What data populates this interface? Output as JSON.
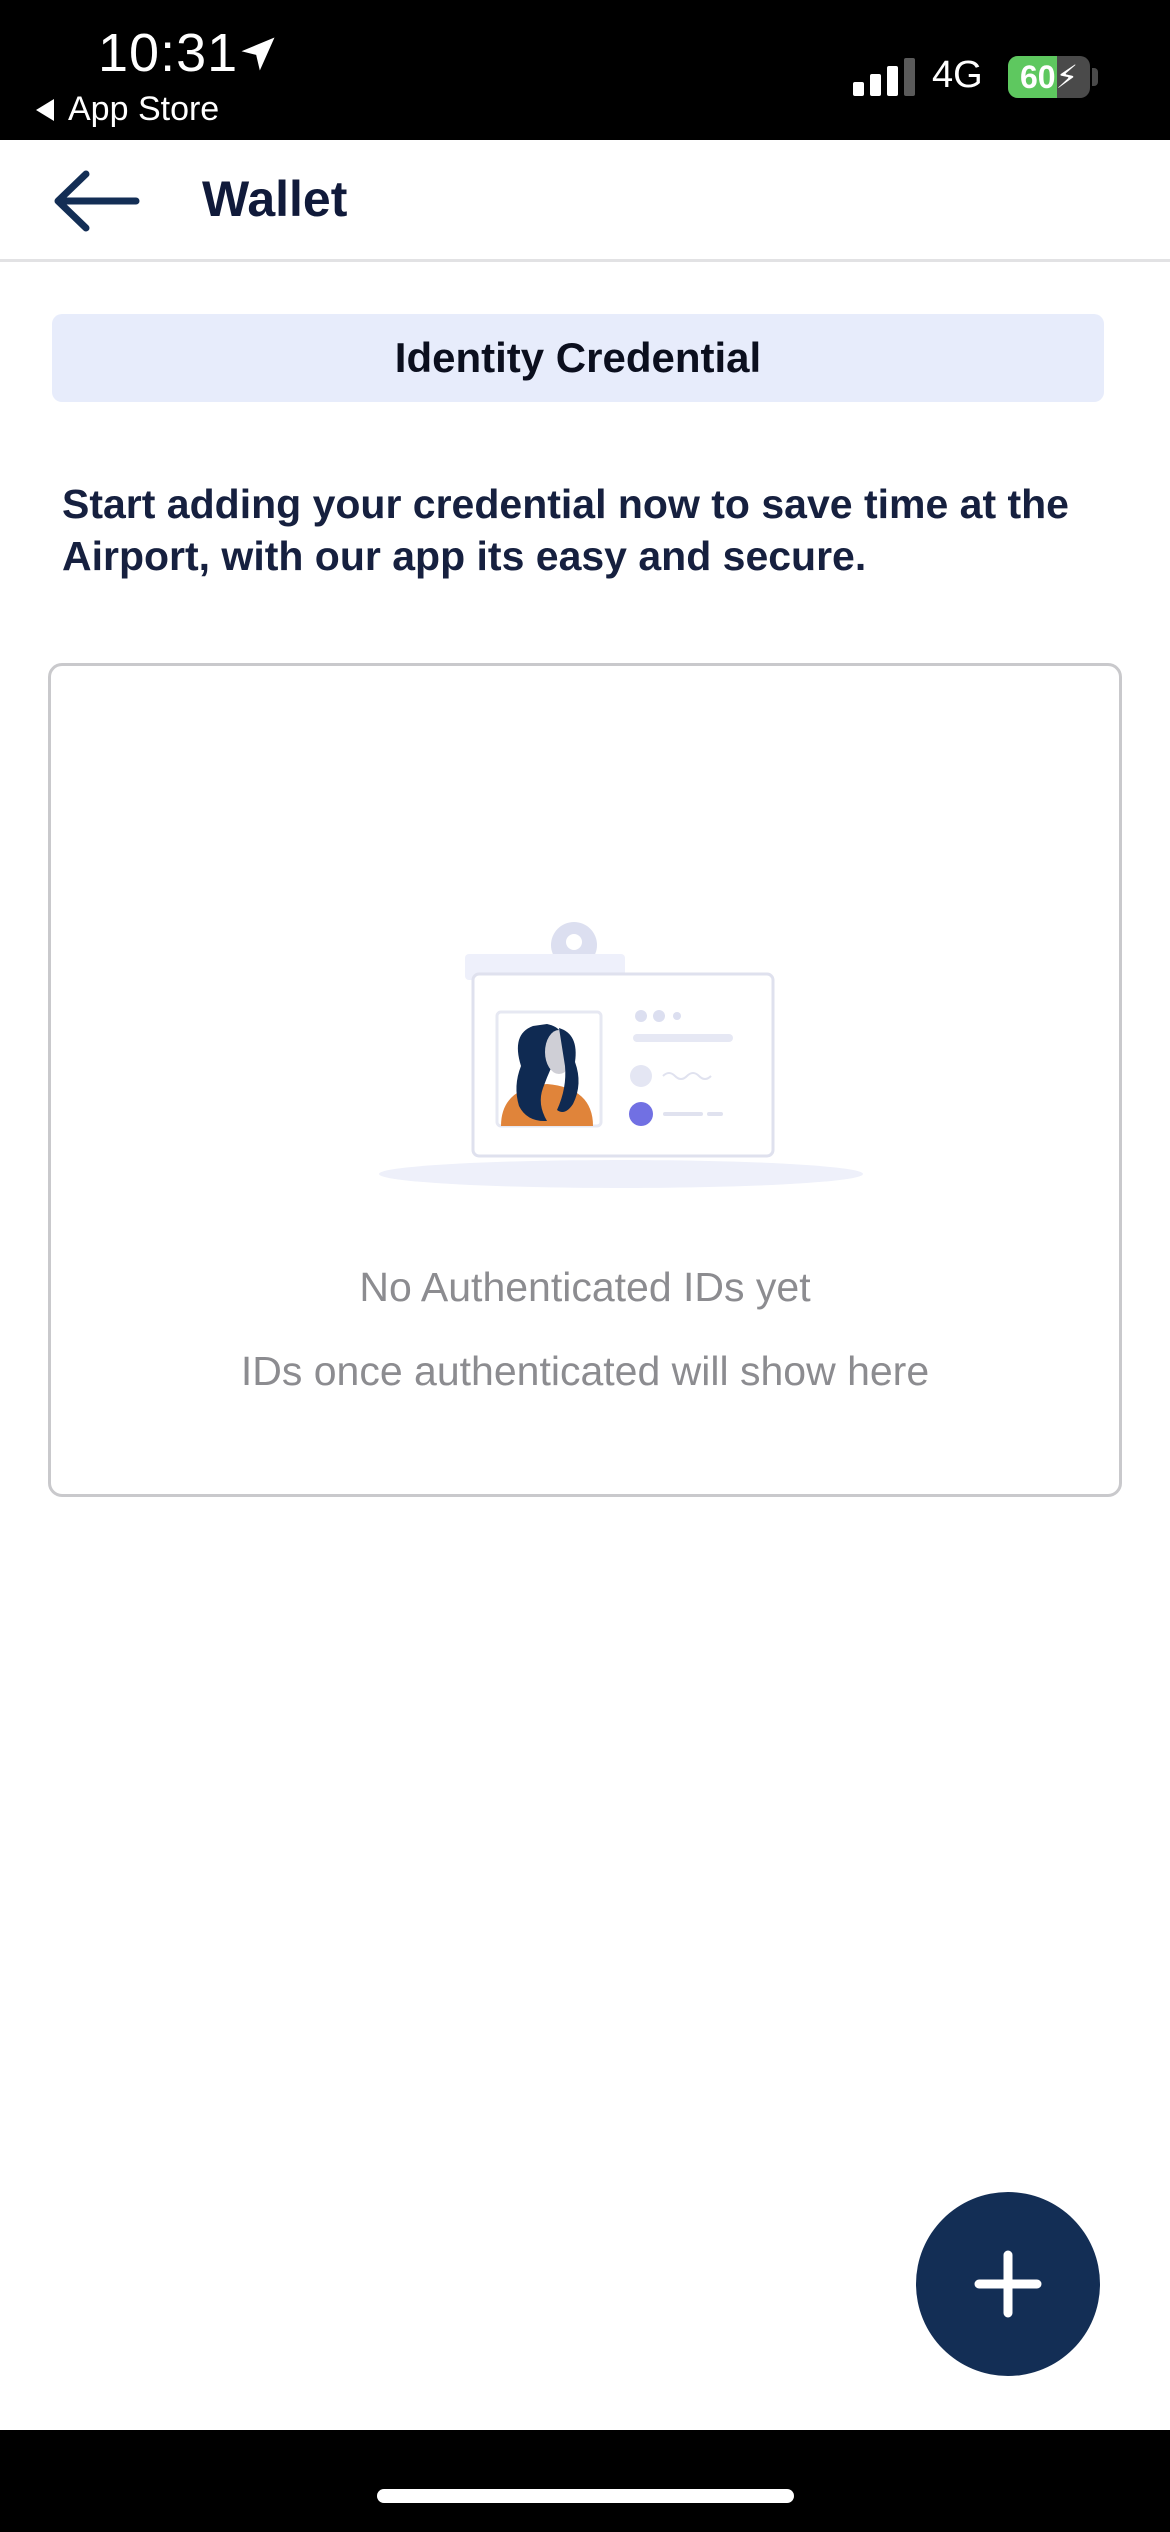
{
  "status_bar": {
    "time": "10:31",
    "back_app": "App Store",
    "network": "4G",
    "battery": "60",
    "battery_level": 0.6,
    "location_icon": "location-arrow-icon",
    "signal_icon": "signal-bars-icon",
    "charging_icon": "bolt-icon"
  },
  "header": {
    "title": "Wallet",
    "back_icon": "arrow-left-icon"
  },
  "segment": {
    "label": "Identity Credential"
  },
  "intro": {
    "text": "Start adding your credential now to save time at the Airport, with our app its easy and secure."
  },
  "empty_state": {
    "illustration_icon": "id-badge-illustration",
    "title": "No Authenticated IDs yet",
    "subtitle": "IDs once authenticated will show here"
  },
  "fab": {
    "icon": "plus-icon"
  },
  "colors": {
    "navy": "#132e55",
    "title_text": "#101a3a",
    "segment_bg": "#e7ecfb",
    "muted_text": "#8c8c90",
    "battery_green": "#5ec85f"
  }
}
